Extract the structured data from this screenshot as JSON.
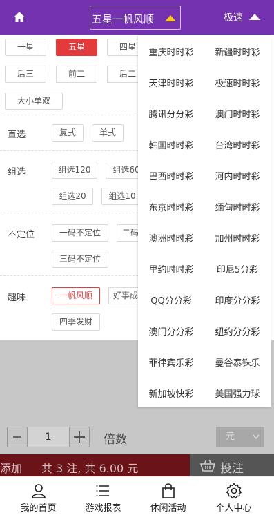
{
  "header": {
    "title": "五星一帆风顺",
    "speed_label": "极速"
  },
  "star_tabs": [
    "一星",
    "五星",
    "四星",
    "后三",
    "前二",
    "后二",
    "大小单双"
  ],
  "play_rows": {
    "direct": {
      "label": "直选",
      "options": [
        "复式",
        "单式"
      ]
    },
    "group": {
      "label": "组选",
      "options": [
        "组选120",
        "组选60",
        "组选20",
        "组选10"
      ]
    },
    "position": {
      "label": "不定位",
      "options": [
        "一码不定位",
        "二码",
        "三码不定位"
      ]
    },
    "fun": {
      "label": "趣味",
      "options": [
        "一帆风顺",
        "好事成",
        "四季发财"
      ]
    }
  },
  "lottery_menu": [
    "重庆时时彩",
    "新疆时时彩",
    "天津时时彩",
    "极速时时彩",
    "腾讯分分彩",
    "澳门时时彩",
    "韩国时时彩",
    "台湾时时彩",
    "巴西时时彩",
    "河内时时彩",
    "东京时时彩",
    "缅甸时时彩",
    "澳洲时时彩",
    "加州时时彩",
    "里约时时彩",
    "印尼5分彩",
    "QQ分分彩",
    "印度分分彩",
    "澳门分分彩",
    "纽约分分彩",
    "菲律宾乐彩",
    "曼谷泰铢乐",
    "新加坡快彩",
    "美国强力球"
  ],
  "multiplier": {
    "quantity": "1",
    "label": "倍数",
    "unit": "元"
  },
  "action_bar": {
    "add_label": "添加",
    "total_text": "共 3 注, 共 6.00 元",
    "bet_label": "投注"
  },
  "tabs": [
    {
      "label": "我的首页",
      "icon": "user-icon"
    },
    {
      "label": "游戏报表",
      "icon": "list-icon"
    },
    {
      "label": "休闲活动",
      "icon": "bag-icon"
    },
    {
      "label": "个人中心",
      "icon": "gear-icon"
    }
  ],
  "colors": {
    "header": "#7432b0",
    "active_tab": "#e33b3b",
    "add_bar": "#6a141a"
  }
}
